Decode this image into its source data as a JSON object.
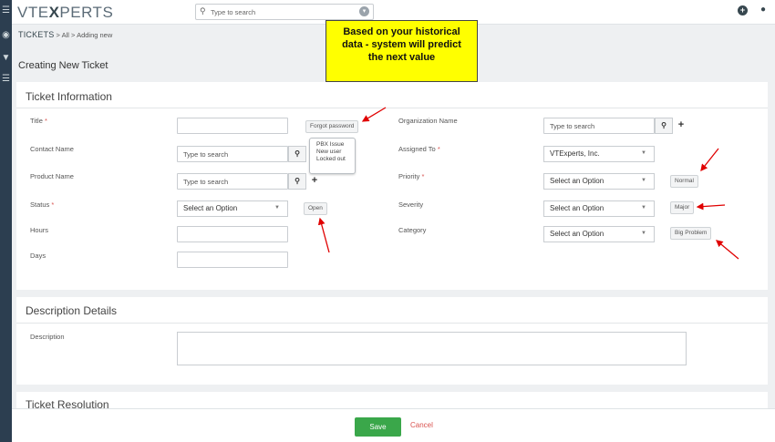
{
  "app": {
    "logo_a": "VTE",
    "logo_x": "X",
    "logo_b": "PERTS"
  },
  "topbar": {
    "search_placeholder": "Type to search"
  },
  "breadcrumb": {
    "module": "TICKETS",
    "sep1": ">",
    "all": "All",
    "sep2": ">",
    "current": "Adding new"
  },
  "page": {
    "title": "Creating New Ticket"
  },
  "banner": {
    "line1": "Based on your historical",
    "line2": "data - system will predict",
    "line3": "the next value"
  },
  "ticket_info": {
    "title": "Ticket Information",
    "fields": {
      "title_label": "Title",
      "contact_label": "Contact Name",
      "product_label": "Product Name",
      "status_label": "Status",
      "hours_label": "Hours",
      "days_label": "Days",
      "org_label": "Organization Name",
      "assigned_label": "Assigned To",
      "priority_label": "Priority",
      "severity_label": "Severity",
      "category_label": "Category",
      "required_mark": "*",
      "search_placeholder": "Type to search",
      "status_value": "Select an Option",
      "assigned_value": "VTExperts, Inc.",
      "priority_value": "Select an Option",
      "severity_value": "Select an Option",
      "category_value": "Select an Option"
    },
    "predictions": {
      "title": "Forgot password",
      "status": "Open",
      "priority": "Normal",
      "severity": "Major",
      "category": "Big Problem"
    },
    "title_suggestions": [
      "PBX Issue",
      "New user",
      "Locked out"
    ]
  },
  "description": {
    "title": "Description Details",
    "label": "Description"
  },
  "resolution": {
    "title": "Ticket Resolution"
  },
  "footer": {
    "save": "Save",
    "cancel": "Cancel"
  },
  "colors": {
    "accent_green": "#3aa74a",
    "cancel_red": "#d9534f",
    "banner_yellow": "#ffff00",
    "arrow_red": "#e00000"
  }
}
